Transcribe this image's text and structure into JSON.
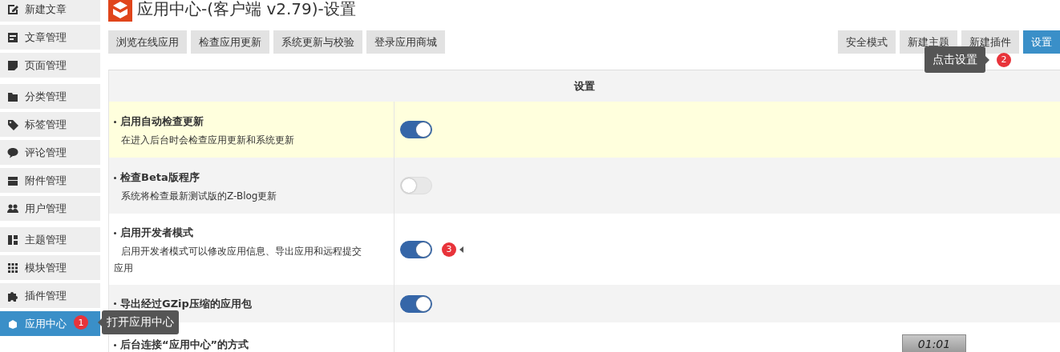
{
  "header": {
    "title": "应用中心-(客户端 v2.79)-设置"
  },
  "sidebar": {
    "groups": [
      [
        {
          "label": "新建文章",
          "kind": "pencil",
          "selected": false
        },
        {
          "label": "文章管理",
          "kind": "document",
          "selected": false
        },
        {
          "label": "页面管理",
          "kind": "page",
          "selected": false
        }
      ],
      [
        {
          "label": "分类管理",
          "kind": "folder",
          "selected": false
        },
        {
          "label": "标签管理",
          "kind": "tag",
          "selected": false
        },
        {
          "label": "评论管理",
          "kind": "comment",
          "selected": false
        },
        {
          "label": "附件管理",
          "kind": "archive",
          "selected": false
        },
        {
          "label": "用户管理",
          "kind": "users",
          "selected": false
        }
      ],
      [
        {
          "label": "主题管理",
          "kind": "layout",
          "selected": false
        },
        {
          "label": "模块管理",
          "kind": "grid",
          "selected": false
        },
        {
          "label": "插件管理",
          "kind": "puzzle",
          "selected": false
        },
        {
          "label": "应用中心",
          "kind": "cloud",
          "selected": true
        }
      ]
    ]
  },
  "toolbar": {
    "left": [
      {
        "label": "浏览在线应用",
        "selected": false
      },
      {
        "label": "检查应用更新",
        "selected": false
      },
      {
        "label": "系统更新与校验",
        "selected": false
      },
      {
        "label": "登录应用商城",
        "selected": false
      }
    ],
    "right": [
      {
        "label": "安全模式",
        "selected": false
      },
      {
        "label": "新建主题",
        "selected": false
      },
      {
        "label": "新建插件",
        "selected": false
      },
      {
        "label": "设置",
        "selected": true
      }
    ]
  },
  "settings": {
    "heading": "设置",
    "rows": [
      {
        "title": "启用自动检查更新",
        "description": "在进入后台时会检查应用更新和系统更新",
        "on": true,
        "highlighted": true
      },
      {
        "title": "检查Beta版程序",
        "description": "系统将检查最新测试版的Z-Blog更新",
        "on": false,
        "highlighted": false
      },
      {
        "title": "启用开发者模式",
        "description": "启用开发者模式可以修改应用信息、导出应用和远程提交应用",
        "on": true,
        "highlighted": false
      },
      {
        "title": "导出经过GZip压缩的应用包",
        "on": true,
        "highlighted": false
      }
    ],
    "last_row": {
      "title": "后台连接“应用中心”的方式"
    }
  },
  "tips": [
    {
      "number": "1",
      "text": "打开应用中心"
    },
    {
      "number": "2",
      "text": "点击设置"
    },
    {
      "number": "3"
    }
  ],
  "timer": "01:01"
}
